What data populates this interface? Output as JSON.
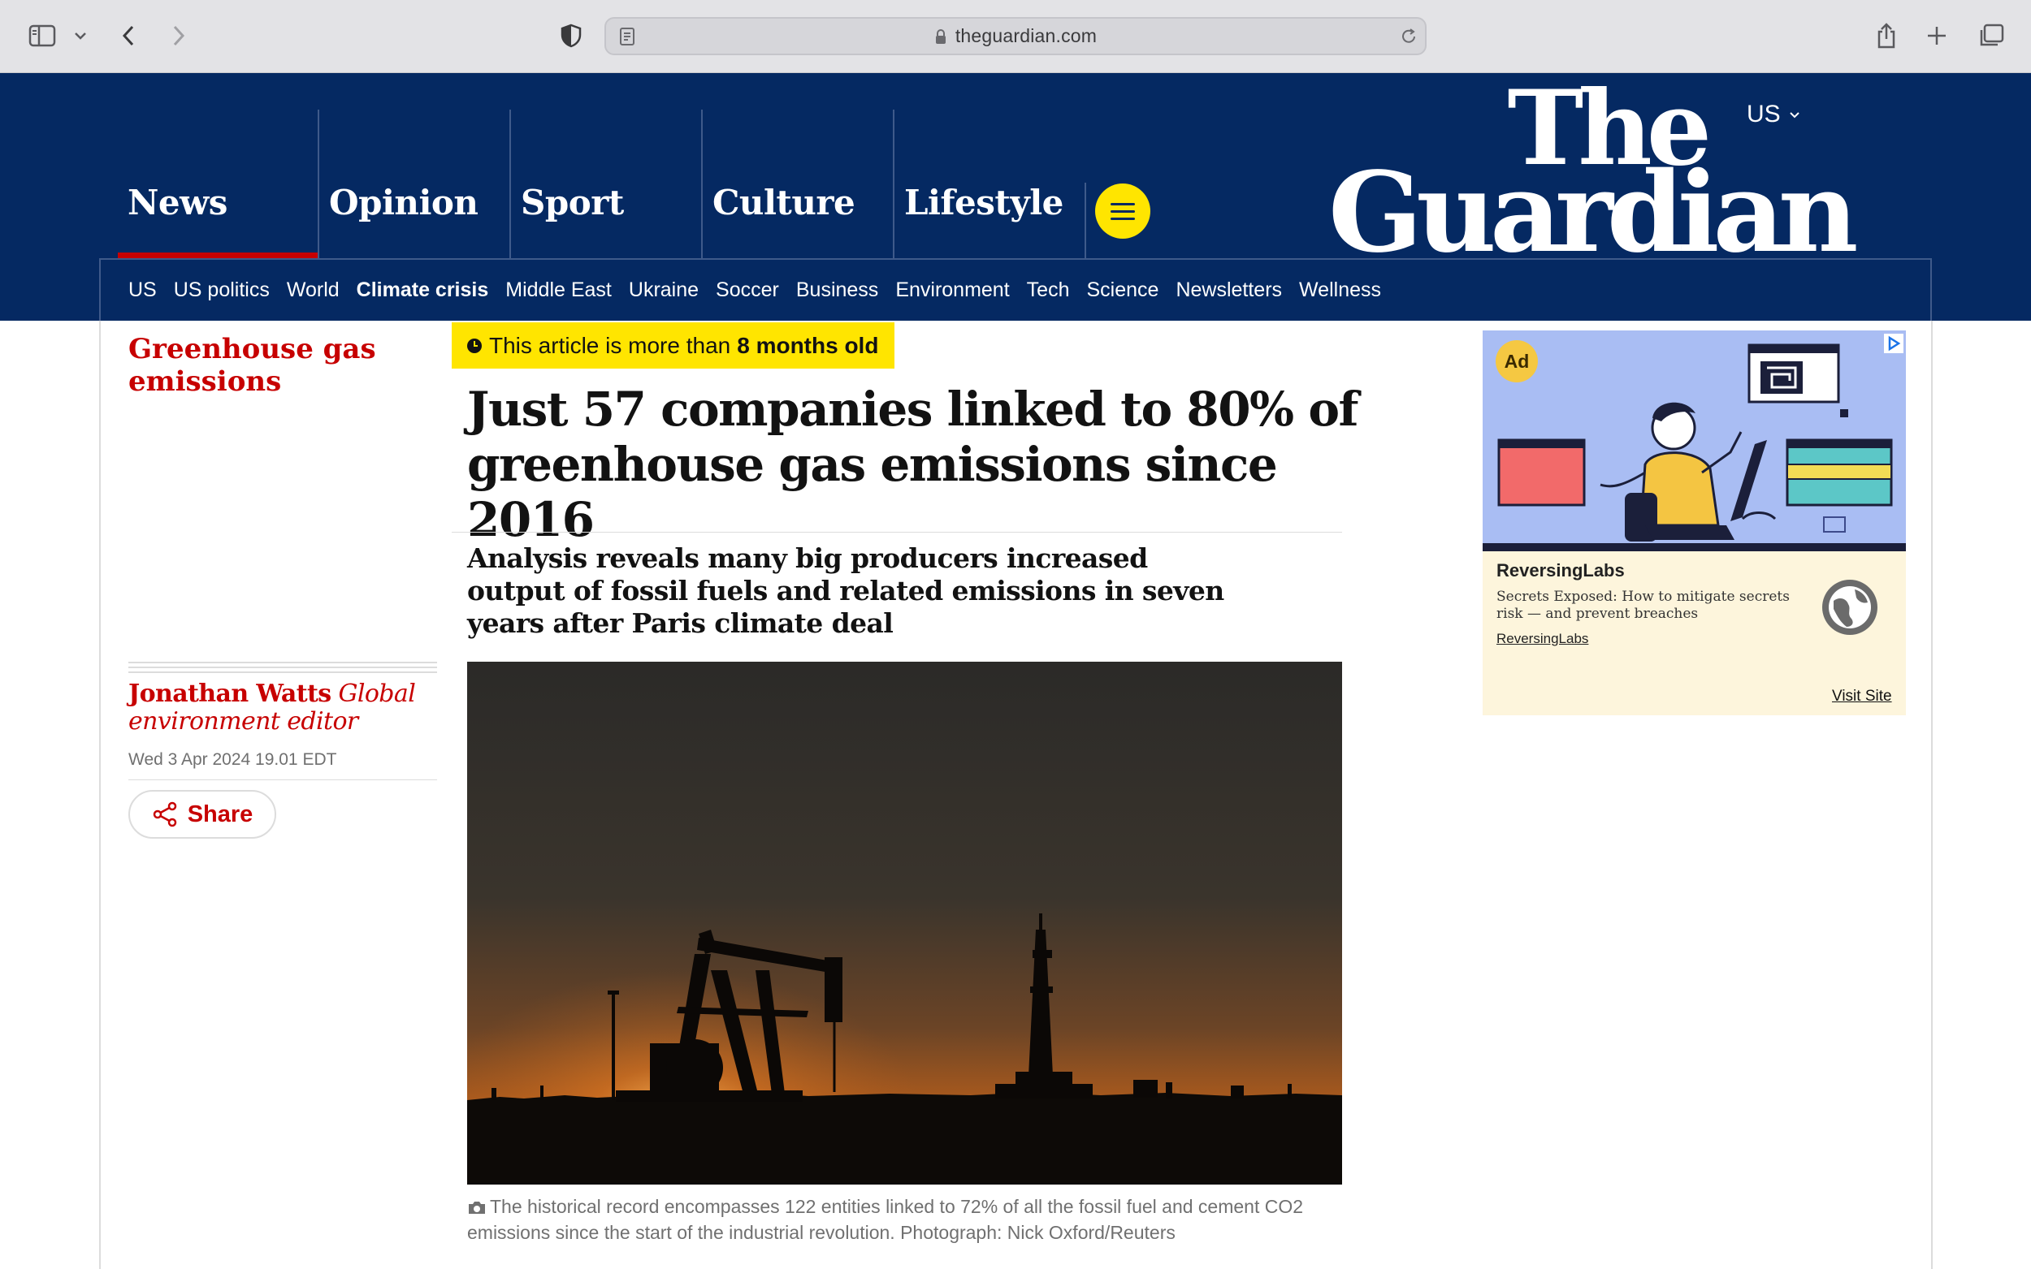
{
  "browser": {
    "url": "theguardian.com"
  },
  "header": {
    "pillars": [
      {
        "label": "News",
        "active": true
      },
      {
        "label": "Opinion",
        "active": false
      },
      {
        "label": "Sport",
        "active": false
      },
      {
        "label": "Culture",
        "active": false
      },
      {
        "label": "Lifestyle",
        "active": false
      }
    ],
    "logo": {
      "line1": "The",
      "line2": "Guardian"
    },
    "edition": "US",
    "subnav": [
      "US",
      "US politics",
      "World",
      "Climate crisis",
      "Middle East",
      "Ukraine",
      "Soccer",
      "Business",
      "Environment",
      "Tech",
      "Science",
      "Newsletters",
      "Wellness"
    ],
    "subnav_bold": "Climate crisis"
  },
  "article": {
    "kicker": "Greenhouse gas emissions",
    "age_notice": {
      "prefix": "This article is more than",
      "emphasis": "8 months old"
    },
    "headline": "Just 57 companies linked to 80% of greenhouse gas emissions since 2016",
    "standfirst": "Analysis reveals many big producers increased output of fossil fuels and related emissions in seven years after Paris climate deal",
    "byline": {
      "name": "Jonathan Watts",
      "role": "Global environment editor"
    },
    "dateline": "Wed 3 Apr 2024 19.01 EDT",
    "share_label": "Share",
    "image_caption": "The historical record encompasses 122 entities linked to 72% of all the fossil fuel and cement CO2 emissions since the start of the industrial revolution. Photograph: Nick Oxford/Reuters"
  },
  "ad": {
    "label": "Ad",
    "brand": "ReversingLabs",
    "copy": "Secrets Exposed: How to mitigate secrets risk — and prevent breaches",
    "link": "ReversingLabs",
    "visit": "Visit Site"
  },
  "colors": {
    "brand_navy": "#052962",
    "news_red": "#c70000",
    "highlight_yellow": "#ffe500"
  }
}
